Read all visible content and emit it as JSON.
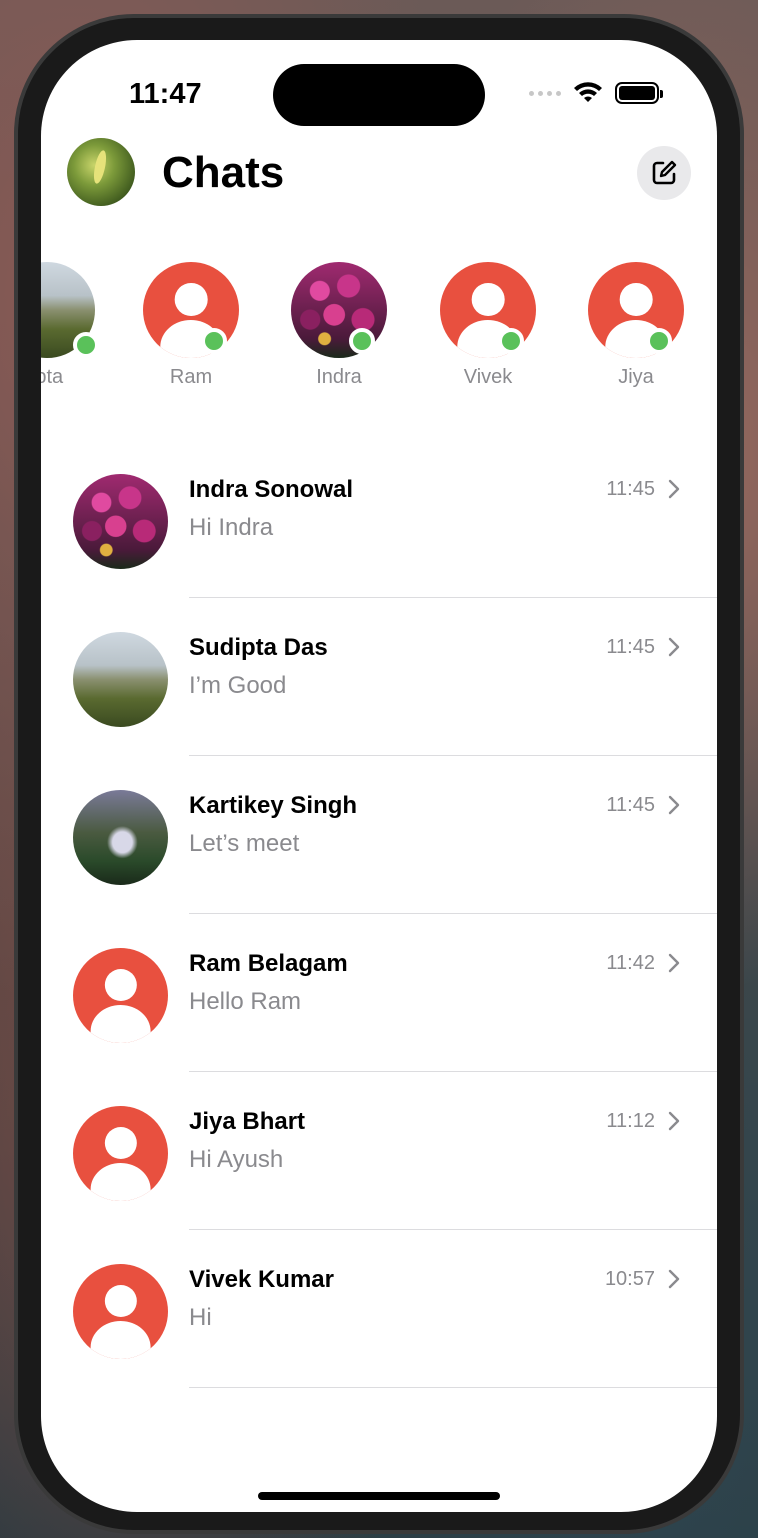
{
  "status_bar": {
    "time": "11:47"
  },
  "header": {
    "title": "Chats",
    "compose_icon": "compose-icon"
  },
  "stories": [
    {
      "label": "Sudipta",
      "visible_label": "ipta",
      "avatar": "photo-field",
      "online": true
    },
    {
      "label": "Ram",
      "avatar": "default",
      "online": true
    },
    {
      "label": "Indra",
      "avatar": "photo-flowers",
      "online": true
    },
    {
      "label": "Vivek",
      "avatar": "default",
      "online": true
    },
    {
      "label": "Jiya",
      "avatar": "default",
      "online": true
    }
  ],
  "chats": [
    {
      "name": "Indra Sonowal",
      "preview": "Hi Indra",
      "time": "11:45",
      "avatar": "photo-flowers"
    },
    {
      "name": "Sudipta Das",
      "preview": "I’m Good",
      "time": "11:45",
      "avatar": "photo-field"
    },
    {
      "name": "Kartikey Singh",
      "preview": "Let’s meet",
      "time": "11:45",
      "avatar": "photo-waterfall"
    },
    {
      "name": "Ram Belagam",
      "preview": "Hello Ram",
      "time": "11:42",
      "avatar": "default"
    },
    {
      "name": "Jiya Bhart",
      "preview": "Hi Ayush",
      "time": "11:12",
      "avatar": "default"
    },
    {
      "name": "Vivek Kumar",
      "preview": "Hi",
      "time": "10:57",
      "avatar": "default"
    }
  ],
  "colors": {
    "accent": "#e8503f",
    "online": "#5ac15a",
    "secondary_text": "#8a8a8e"
  }
}
